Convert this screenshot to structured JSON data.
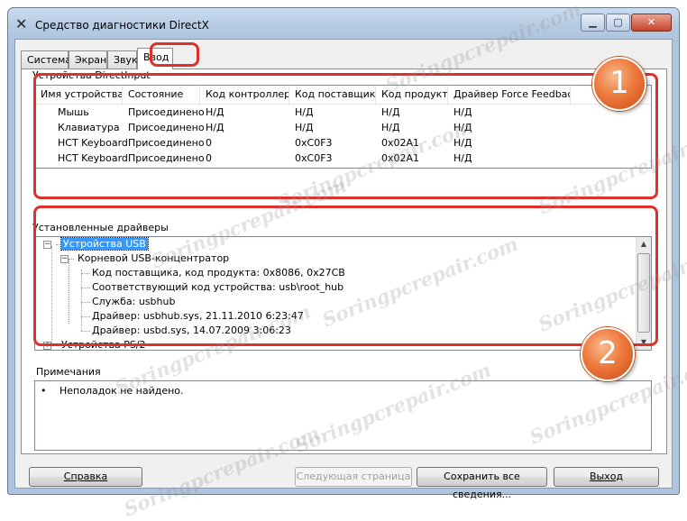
{
  "window": {
    "title": "Средство диагностики DirectX"
  },
  "tabs": [
    {
      "label": "Система"
    },
    {
      "label": "Экран"
    },
    {
      "label": "Звук"
    },
    {
      "label": "Ввод"
    }
  ],
  "devices": {
    "group_label": "Устройства DirectInput",
    "columns": [
      "Имя устройства",
      "Состояние",
      "Код контроллера",
      "Код поставщика",
      "Код продукта",
      "Драйвер Force Feedback"
    ],
    "rows": [
      [
        "Мышь",
        "Присоединено",
        "Н/Д",
        "Н/Д",
        "Н/Д",
        "Н/Д"
      ],
      [
        "Клавиатура",
        "Присоединено",
        "Н/Д",
        "Н/Д",
        "Н/Д",
        "Н/Д"
      ],
      [
        "HCT Keyboard",
        "Присоединено",
        "0",
        "0xC0F3",
        "0x02A1",
        "Н/Д"
      ],
      [
        "HCT Keyboard",
        "Присоединено",
        "0",
        "0xC0F3",
        "0x02A1",
        "Н/Д"
      ]
    ]
  },
  "drivers": {
    "group_label": "Установленные драйверы",
    "tree": {
      "usb": "Устройства USB",
      "hub": "Корневой USB-концентратор",
      "details": [
        "Код поставщика, код продукта: 0x8086, 0x27CB",
        "Соответствующий код устройства: usb\\root_hub",
        "Служба: usbhub",
        "Драйвер: usbhub.sys, 21.11.2010 6:23:47",
        "Драйвер: usbd.sys, 14.07.2009 3:06:23"
      ],
      "ps2": "Устройства PS/2"
    }
  },
  "notes": {
    "group_label": "Примечания",
    "items": [
      "Неполадок не найдено."
    ]
  },
  "buttons": {
    "help": "Справка",
    "next_page": "Следующая страница",
    "save_all": "Сохранить все сведения...",
    "exit": "Выход"
  },
  "callouts": [
    "1",
    "2"
  ],
  "watermark": "Soringpcrepair.com",
  "colors": {
    "callout_border": "#e0302a",
    "badge": "#ee7a3e",
    "selection": "#3399ff"
  }
}
